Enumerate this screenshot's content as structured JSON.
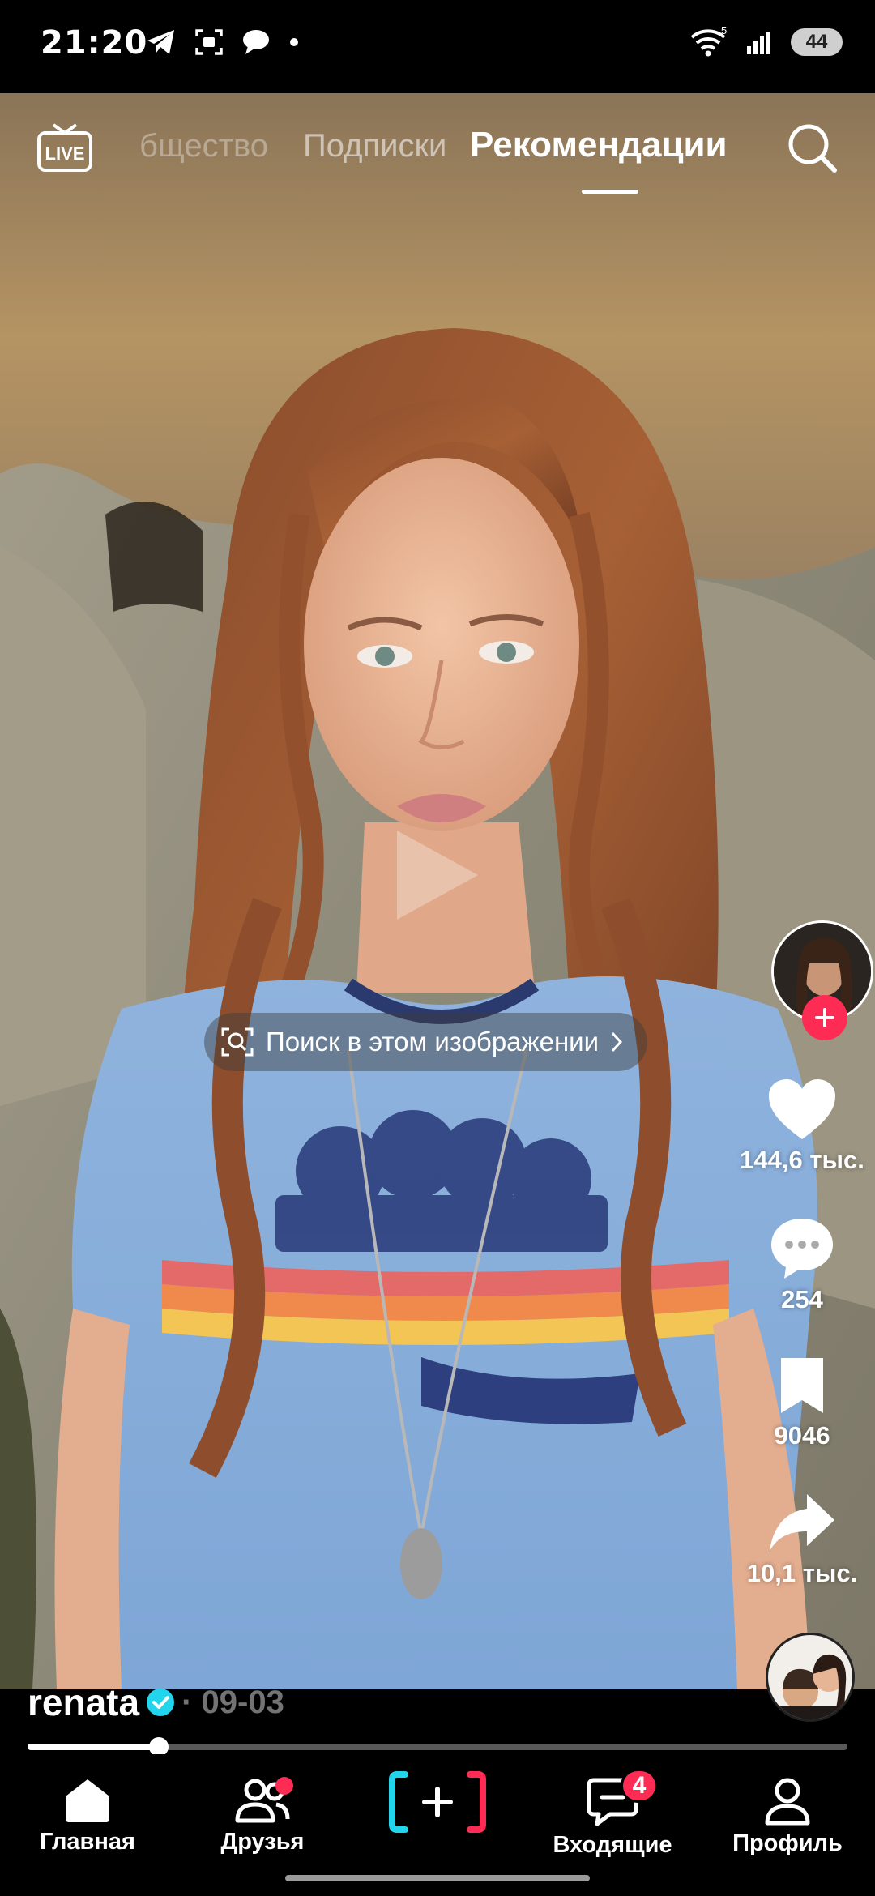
{
  "status_bar": {
    "time": "21:20",
    "battery": "44",
    "network_badge": "5"
  },
  "top_nav": {
    "live_label": "LIVE",
    "tabs": [
      {
        "label": "Общество",
        "visible_text": "бщество"
      },
      {
        "label": "Подписки"
      },
      {
        "label": "Рекомендации",
        "active": true
      }
    ]
  },
  "image_search": {
    "label": "Поиск в этом изображении"
  },
  "actions": {
    "likes": "144,6 тыс.",
    "comments": "254",
    "saves": "9046",
    "shares": "10,1 тыс."
  },
  "caption": {
    "username": "renata",
    "date": "· 09-03"
  },
  "progress": {
    "fraction": 0.16
  },
  "bottom_nav": {
    "home": "Главная",
    "friends": "Друзья",
    "inbox": "Входящие",
    "inbox_badge": "4",
    "profile": "Профиль"
  },
  "colors": {
    "accent": "#fe2c55",
    "create_left": "#20d5ec",
    "create_right": "#fe2c55",
    "verified": "#20d5ec"
  }
}
